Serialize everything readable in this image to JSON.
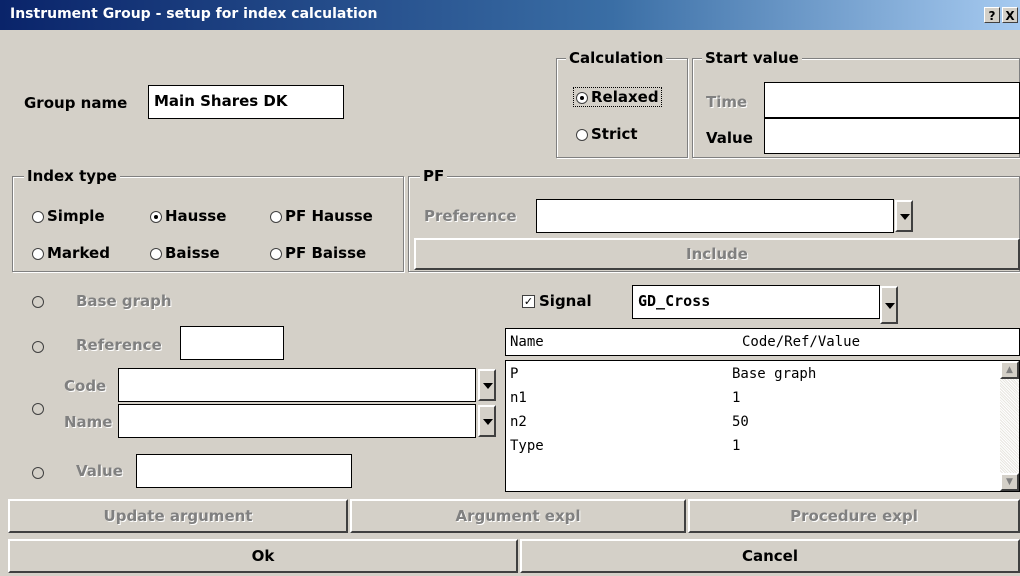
{
  "window": {
    "title": "Instrument Group - setup for index calculation",
    "help_button": "?",
    "close_button": "X"
  },
  "group_name": {
    "label": "Group name",
    "value": "Main Shares DK"
  },
  "calculation": {
    "title": "Calculation",
    "options": [
      "Relaxed",
      "Strict"
    ],
    "selected": "Relaxed"
  },
  "start_value": {
    "title": "Start value",
    "time_label": "Time",
    "time_value": "",
    "value_label": "Value",
    "value_value": ""
  },
  "index_type": {
    "title": "Index type",
    "options": [
      "Simple",
      "Hausse",
      "PF Hausse",
      "Marked",
      "Baisse",
      "PF Baisse"
    ],
    "selected": "Hausse"
  },
  "pf": {
    "title": "PF",
    "preference_label": "Preference",
    "preference_value": "",
    "include_button": "Include"
  },
  "argument": {
    "base_graph_label": "Base graph",
    "reference_label": "Reference",
    "reference_value": "",
    "code_label": "Code",
    "code_value": "",
    "name_label": "Name",
    "name_value": "",
    "value_label": "Value",
    "value_value": ""
  },
  "signal": {
    "label": "Signal",
    "checked": true,
    "value": "GD_Cross"
  },
  "param_table": {
    "columns": [
      "Name",
      "Code/Ref/Value"
    ],
    "rows": [
      {
        "name": "P",
        "value": "Base graph"
      },
      {
        "name": "n1",
        "value": "1"
      },
      {
        "name": "n2",
        "value": "50"
      },
      {
        "name": "Type",
        "value": "1"
      }
    ]
  },
  "buttons": {
    "update_argument": "Update argument",
    "argument_expl": "Argument expl",
    "procedure_expl": "Procedure expl",
    "ok": "Ok",
    "cancel": "Cancel"
  }
}
